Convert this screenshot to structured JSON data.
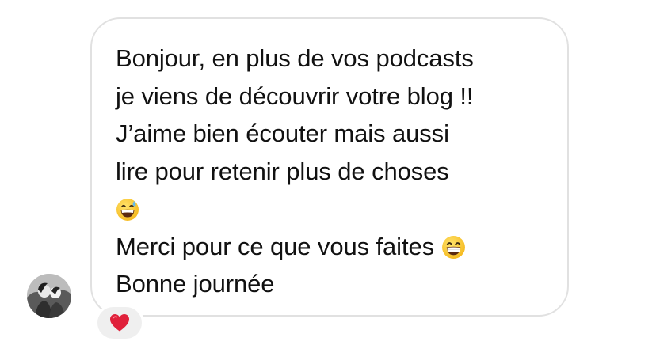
{
  "thread": {
    "incoming_message": {
      "lines": [
        "Bonjour, en plus de vos podcasts",
        "je viens de découvrir votre blog !!",
        "J’aime bien écouter mais aussi",
        "lire pour retenir plus de choses",
        "",
        "Merci pour ce que vous faites",
        "Bonne journée"
      ],
      "emojis": [
        "grinning-face-with-sweat",
        "beaming-face-with-smiling-eyes"
      ],
      "reaction": {
        "icon": "red-heart-icon",
        "color": "#e0213b"
      }
    },
    "sender_avatar": {
      "icon": "user-avatar-photo"
    }
  },
  "colors": {
    "bubble_border": "#e1e1e1",
    "bubble_background": "#ffffff",
    "text": "#111111",
    "reaction_background": "#efefef"
  }
}
